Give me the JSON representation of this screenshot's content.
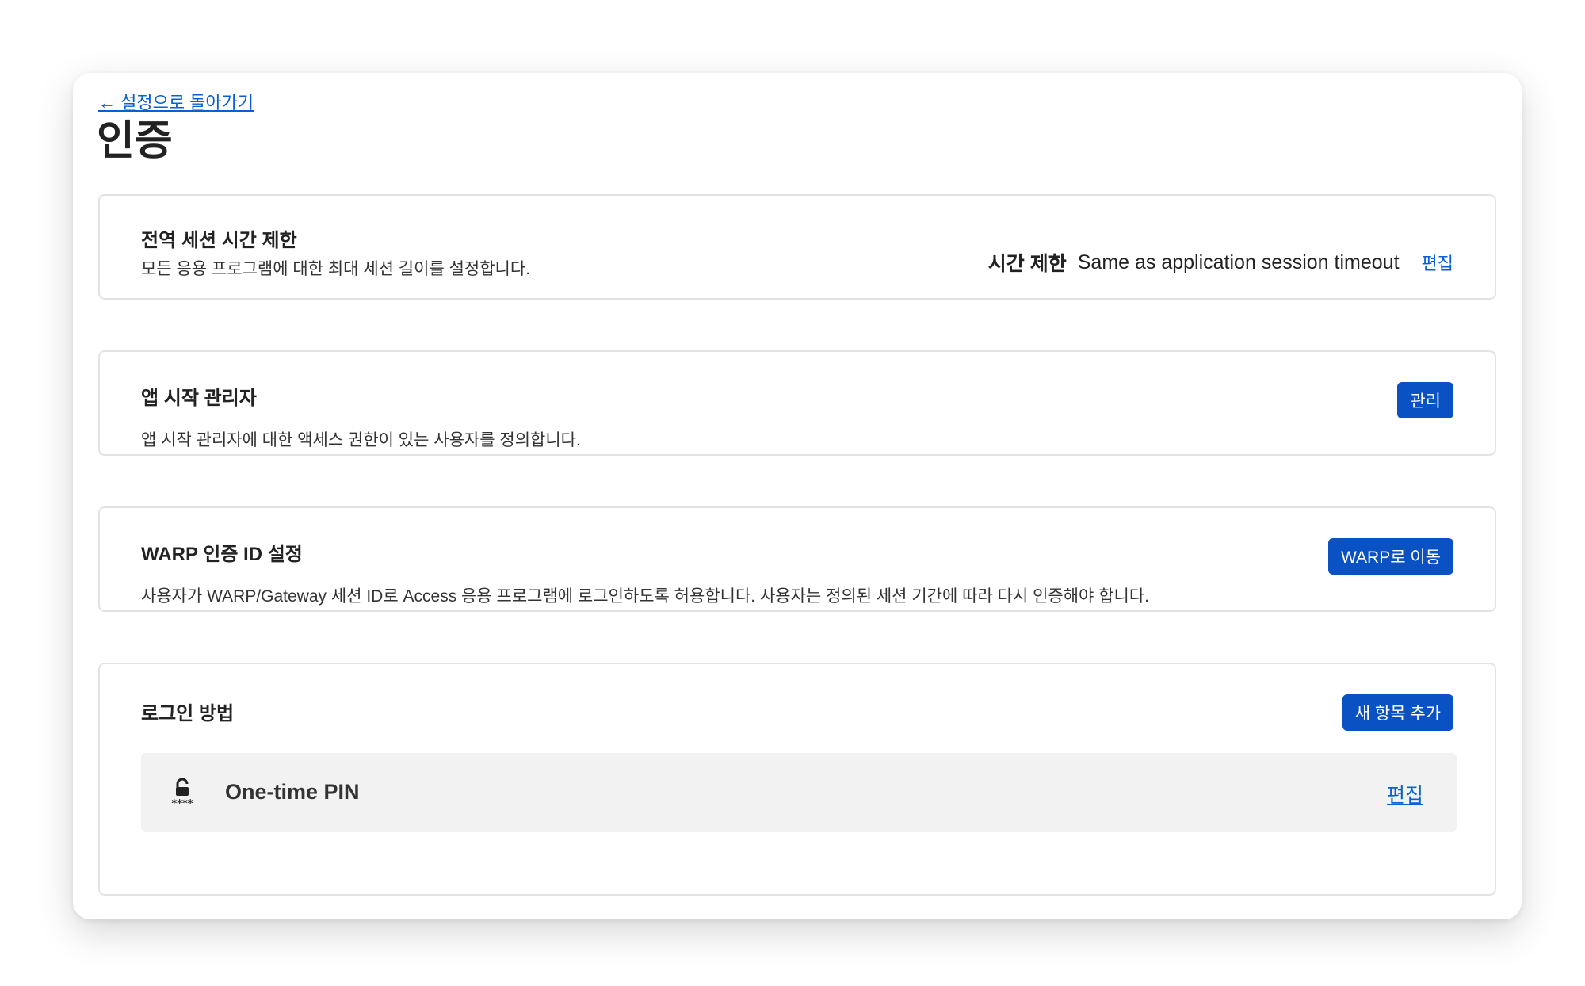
{
  "nav": {
    "back_label": "← 설정으로 돌아가기"
  },
  "page": {
    "title": "인증"
  },
  "session_card": {
    "title": "전역 세션 시간 제한",
    "description": "모든 응용 프로그램에 대한 최대 세션 길이를 설정합니다.",
    "timeout_label": "시간 제한",
    "timeout_value": "Same as application session timeout",
    "edit_label": "편집"
  },
  "launcher_card": {
    "title": "앱 시작 관리자",
    "description": "앱 시작 관리자에 대한 액세스 권한이 있는 사용자를 정의합니다.",
    "button_label": "관리"
  },
  "warp_card": {
    "title": "WARP 인증 ID 설정",
    "description": "사용자가 WARP/Gateway 세션 ID로 Access 응용 프로그램에 로그인하도록 허용합니다. 사용자는 정의된 세션 기간에 따라 다시 인증해야 합니다.",
    "button_label": "WARP로 이동"
  },
  "login_card": {
    "title": "로그인 방법",
    "add_button_label": "새 항목 추가",
    "methods": [
      {
        "icon": "unlock-pin-icon",
        "pin_mask": "****",
        "name": "One-time PIN",
        "edit_label": "편집"
      }
    ]
  },
  "colors": {
    "accent": "#0a52c4",
    "link": "#0b5fd6",
    "border": "#e3e3e3",
    "row_bg": "#f2f2f2"
  }
}
